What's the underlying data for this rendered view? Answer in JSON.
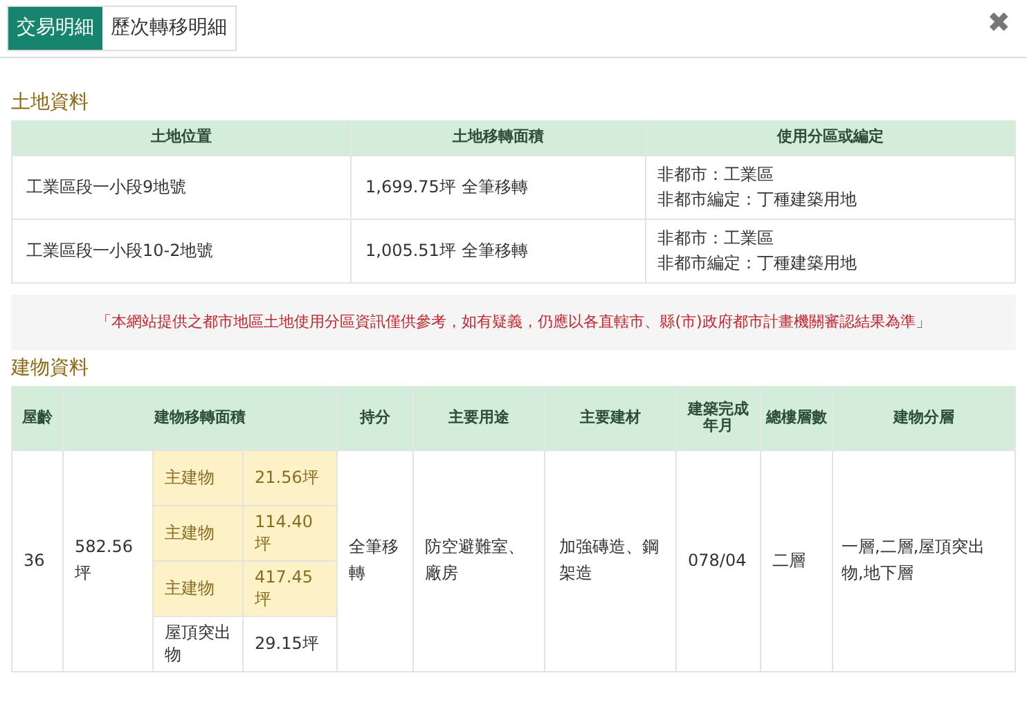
{
  "tabs": [
    {
      "label": "交易明細",
      "selected": true
    },
    {
      "label": "歷次轉移明細",
      "selected": false
    }
  ],
  "close": "✖",
  "land": {
    "title": "土地資料",
    "columns": [
      "土地位置",
      "土地移轉面積",
      "使用分區或編定"
    ],
    "rows": [
      {
        "location": "工業區段一小段9地號",
        "area": "1,699.75坪 全筆移轉",
        "zoning": [
          "非都市：工業區",
          "非都市編定：丁種建築用地"
        ]
      },
      {
        "location": "工業區段一小段10-2地號",
        "area": "1,005.51坪 全筆移轉",
        "zoning": [
          "非都市：工業區",
          "非都市編定：丁種建築用地"
        ]
      }
    ]
  },
  "notice": "「本網站提供之都市地區土地使用分區資訊僅供參考，如有疑義，仍應以各直轄市、縣(市)政府都市計畫機關審認結果為準」",
  "building": {
    "title": "建物資料",
    "columns": [
      "屋齡",
      "建物移轉面積",
      "持分",
      "主要用途",
      "主要建材",
      "建築完成年月",
      "總樓層數",
      "建物分層"
    ],
    "rows": [
      {
        "age": "36",
        "area": "582.56坪",
        "parts": [
          {
            "name": "主建物",
            "value": "21.56坪",
            "highlighted": true
          },
          {
            "name": "主建物",
            "value": "114.40坪",
            "highlighted": true
          },
          {
            "name": "主建物",
            "value": "417.45坪",
            "highlighted": true
          },
          {
            "name": "屋頂突出物",
            "value": "29.15坪",
            "highlighted": false
          }
        ],
        "share": "全筆移轉",
        "use": "防空避難室、廠房",
        "material": "加強磚造、鋼架造",
        "completed": "078/04",
        "floors": "二層",
        "levels": "一層,二層,屋頂突出物,地下層"
      }
    ]
  }
}
